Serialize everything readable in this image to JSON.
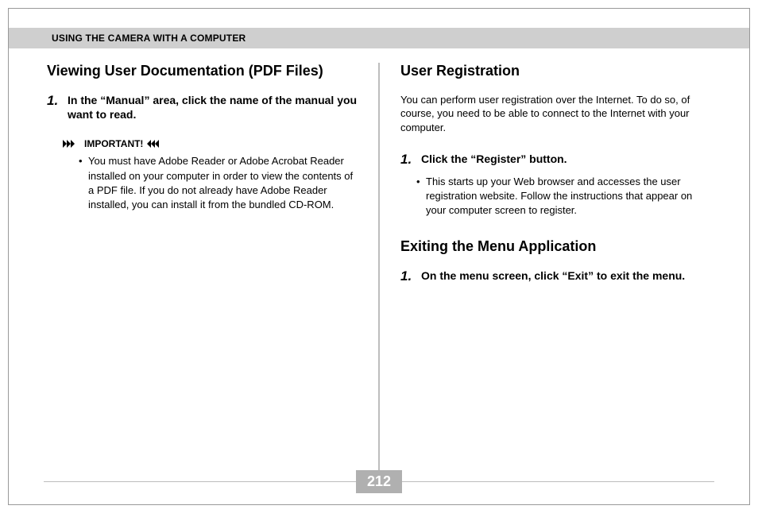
{
  "header": {
    "title": "USING THE CAMERA WITH A COMPUTER"
  },
  "left": {
    "heading": "Viewing User Documentation (PDF Files)",
    "step1": {
      "num": "1.",
      "text": "In the “Manual” area, click the name of the manual you want to read."
    },
    "important": {
      "label": "IMPORTANT!",
      "bullet": "You must have Adobe Reader or Adobe Acrobat Reader installed on your computer in order to view the contents of a PDF file. If you do not already have Adobe Reader installed, you can install it from the bundled CD-ROM."
    }
  },
  "right": {
    "section1": {
      "heading": "User Registration",
      "intro": "You can perform user registration over the Internet. To do so, of course, you need to be able to connect to the Internet with your computer.",
      "step1": {
        "num": "1.",
        "text": "Click the “Register” button."
      },
      "bullet": "This starts up your Web browser and accesses the user registration website. Follow the instructions that appear on your computer screen to register."
    },
    "section2": {
      "heading": "Exiting the Menu Application",
      "step1": {
        "num": "1.",
        "text": "On the menu screen, click “Exit” to exit the menu."
      }
    }
  },
  "page_number": "212"
}
